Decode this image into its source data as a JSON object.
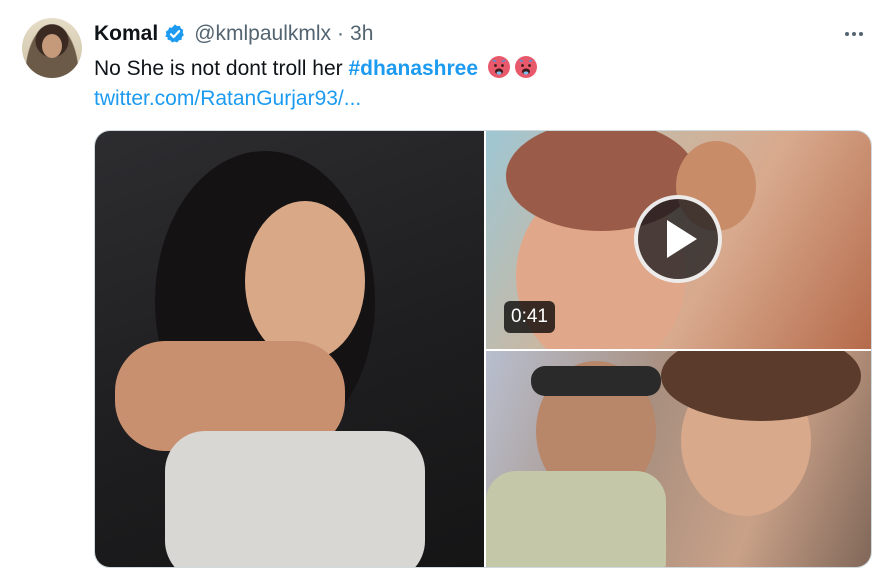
{
  "author": {
    "name": "Komal",
    "handle": "@kmlpaulkmlx",
    "separator": "·",
    "time": "3h",
    "verified": true,
    "avatar_icon": "user-avatar"
  },
  "tweet": {
    "text": "No She is not dont troll her",
    "hashtag": "#dhanashree",
    "emoji_icon": "hot-face-emoji",
    "emoji_count": 2,
    "link": "twitter.com/RatanGurjar93/..."
  },
  "media": {
    "video_duration": "0:41"
  },
  "colors": {
    "accent": "#1d9bf0",
    "secondary_text": "#536471",
    "border": "#cfd9de",
    "verified": "#1d9bf0"
  }
}
